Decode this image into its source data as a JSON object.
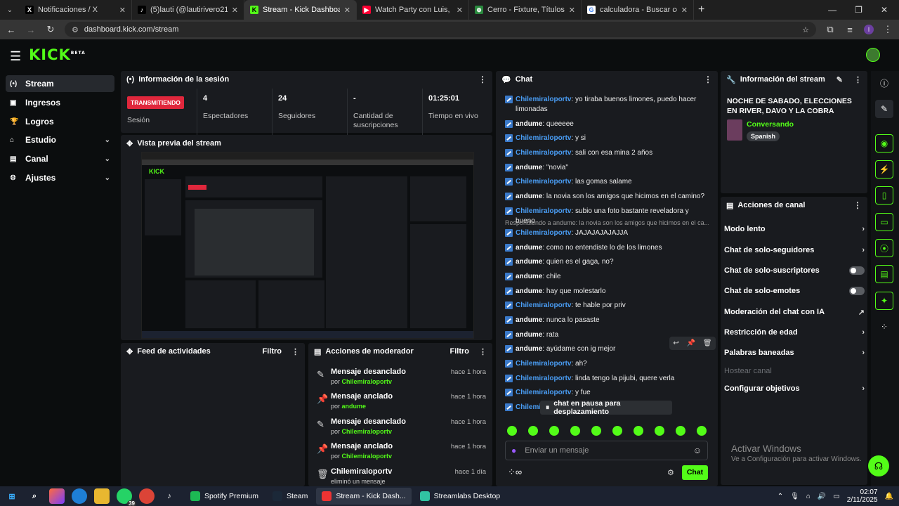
{
  "browser": {
    "tabs": [
      {
        "label": "Notificaciones / X",
        "fav": "X",
        "favbg": "#000000",
        "favfg": "#ffffff"
      },
      {
        "label": "(5)lauti (@lautirivero21) | TikTok",
        "fav": "♪",
        "favbg": "#000000",
        "favfg": "#ffffff"
      },
      {
        "label": "Stream - Kick Dashboard",
        "fav": "K",
        "favbg": "#53fc18",
        "favfg": "#000000"
      },
      {
        "label": "Watch Party con Luis, Davo, La",
        "fav": "▶",
        "favbg": "#ff0033",
        "favfg": "#ffffff"
      },
      {
        "label": "Cerro - Fixture, Títulos y Plantel",
        "fav": "⊕",
        "favbg": "#2a8a3e",
        "favfg": "#ffffff"
      },
      {
        "label": "calculadora - Buscar con Google",
        "fav": "G",
        "favbg": "#ffffff",
        "favfg": "#4285f4"
      }
    ],
    "url": "dashboard.kick.com/stream"
  },
  "sidebar": {
    "items": [
      {
        "label": "Stream",
        "icon": "(•)"
      },
      {
        "label": "Ingresos",
        "icon": "▣"
      },
      {
        "label": "Logros",
        "icon": "🏆"
      },
      {
        "label": "Estudio",
        "icon": "⌂"
      },
      {
        "label": "Canal",
        "icon": "▤"
      },
      {
        "label": "Ajustes",
        "icon": "⚙"
      }
    ]
  },
  "session": {
    "title": "Información de la sesión",
    "badge": "TRANSMITIENDO",
    "session_label": "Sesión",
    "stats": [
      {
        "value": "4",
        "label": "Espectadores"
      },
      {
        "value": "24",
        "label": "Seguidores"
      },
      {
        "value": "-",
        "label": "Cantidad de suscripciones"
      },
      {
        "value": "01:25:01",
        "label": "Tiempo en vivo"
      }
    ]
  },
  "preview": {
    "title": "Vista previa del stream"
  },
  "activity": {
    "title": "Feed de actividades",
    "filter": "Filtro"
  },
  "modactions": {
    "title": "Acciones de moderador",
    "filter": "Filtro",
    "rows": [
      {
        "title": "Mensaje desanclado",
        "by": "por",
        "user": "Chilemiraloportv",
        "time": "hace 1 hora",
        "icon": "✎"
      },
      {
        "title": "Mensaje anclado",
        "by": "por",
        "user": "andume",
        "time": "hace 1 hora",
        "icon": "📌"
      },
      {
        "title": "Mensaje desanclado",
        "by": "por",
        "user": "Chilemiraloportv",
        "time": "hace 1 hora",
        "icon": "✎"
      },
      {
        "title": "Mensaje anclado",
        "by": "por",
        "user": "Chilemiraloportv",
        "time": "hace 1 hora",
        "icon": "📌"
      },
      {
        "title": "Chilemiraloportv",
        "by": "eliminó un mensaje",
        "user": "",
        "time": "hace 1 día",
        "icon": "🗑"
      }
    ]
  },
  "chat": {
    "title": "Chat",
    "colors": {
      "chile": "#4a9ef6",
      "andume": "#ffffff"
    },
    "messages": [
      {
        "user": "Chilemiraloportv",
        "text": "yo tiraba buenos limones, puedo hacer limonadas",
        "c": "chile"
      },
      {
        "user": "andume",
        "text": "queeeee",
        "c": "andume"
      },
      {
        "user": "Chilemiraloportv",
        "text": "y si",
        "c": "chile"
      },
      {
        "user": "Chilemiraloportv",
        "text": "sali con esa mina 2 años",
        "c": "chile"
      },
      {
        "user": "andume",
        "text": "\"novia\"",
        "c": "andume"
      },
      {
        "user": "Chilemiraloportv",
        "text": "las gomas salame",
        "c": "chile"
      },
      {
        "user": "andume",
        "text": "la novia son los amigos que hicimos en el camino?",
        "c": "andume"
      },
      {
        "user": "Chilemiraloportv",
        "text": "subio una foto bastante reveladora y bueno",
        "c": "chile"
      },
      {
        "user": "Chilemiraloportv",
        "text": "JAJAJAJAJAJJA",
        "c": "chile",
        "reply": "Respondiendo a andume: la novia son los amigos que hicimos en el ca..."
      },
      {
        "user": "andume",
        "text": "como no entendiste lo de los limones",
        "c": "andume"
      },
      {
        "user": "andume",
        "text": "quien es el gaga, no?",
        "c": "andume"
      },
      {
        "user": "andume",
        "text": "chile",
        "c": "andume"
      },
      {
        "user": "andume",
        "text": "hay que molestarlo",
        "c": "andume"
      },
      {
        "user": "Chilemiraloportv",
        "text": "te hable por priv",
        "c": "chile"
      },
      {
        "user": "andume",
        "text": "nunca lo pasaste",
        "c": "andume"
      },
      {
        "user": "andume",
        "text": "rata",
        "c": "andume"
      },
      {
        "user": "andume",
        "text": "ayúdame con ig mejor",
        "c": "andume"
      },
      {
        "user": "Chilemiraloportv",
        "text": "ah?",
        "c": "chile"
      },
      {
        "user": "Chilemiraloportv",
        "text": "linda tengo la pijubi, quere verla",
        "c": "chile"
      },
      {
        "user": "Chilemiraloportv",
        "text": "y fue",
        "c": "chile"
      },
      {
        "user": "Chilemi",
        "text": "",
        "c": "chile"
      }
    ],
    "paused": "chat en pausa para desplazamiento",
    "placeholder": "Enviar un mensaje",
    "send": "Chat"
  },
  "streaminfo": {
    "title": "Información del stream",
    "stream_title": "NOCHE DE SABADO, ELECCIONES EN RIVER, DAVO Y LA COBRA ESTUVIERON...",
    "category": "Conversando",
    "language": "Spanish"
  },
  "channel": {
    "title": "Acciones de canal",
    "items": [
      {
        "label": "Modo lento",
        "ctl": "chevron"
      },
      {
        "label": "Chat de solo-seguidores",
        "ctl": "chevron"
      },
      {
        "label": "Chat de solo-suscriptores",
        "ctl": "toggle"
      },
      {
        "label": "Chat de solo-emotes",
        "ctl": "toggle"
      },
      {
        "label": "Moderación del chat con IA",
        "ctl": "external"
      },
      {
        "label": "Restricción de edad",
        "ctl": "chevron"
      },
      {
        "label": "Palabras baneadas",
        "ctl": "chevron"
      },
      {
        "label": "Hostear canal",
        "ctl": "disabled"
      },
      {
        "label": "Configurar objetivos",
        "ctl": "chevron"
      }
    ]
  },
  "watermark": {
    "line1": "Activar Windows",
    "line2": "Ve a Configuración para activar Windows."
  },
  "taskbar": {
    "apps": [
      {
        "label": "Spotify Premium",
        "color": "#1db954"
      },
      {
        "label": "Steam",
        "color": "#1b2838"
      },
      {
        "label": "Stream - Kick Dash...",
        "color": "#e33"
      },
      {
        "label": "Streamlabs Desktop",
        "color": "#31c3a2"
      }
    ],
    "badge": "39",
    "time": "02:07",
    "date": "2/11/2025"
  }
}
